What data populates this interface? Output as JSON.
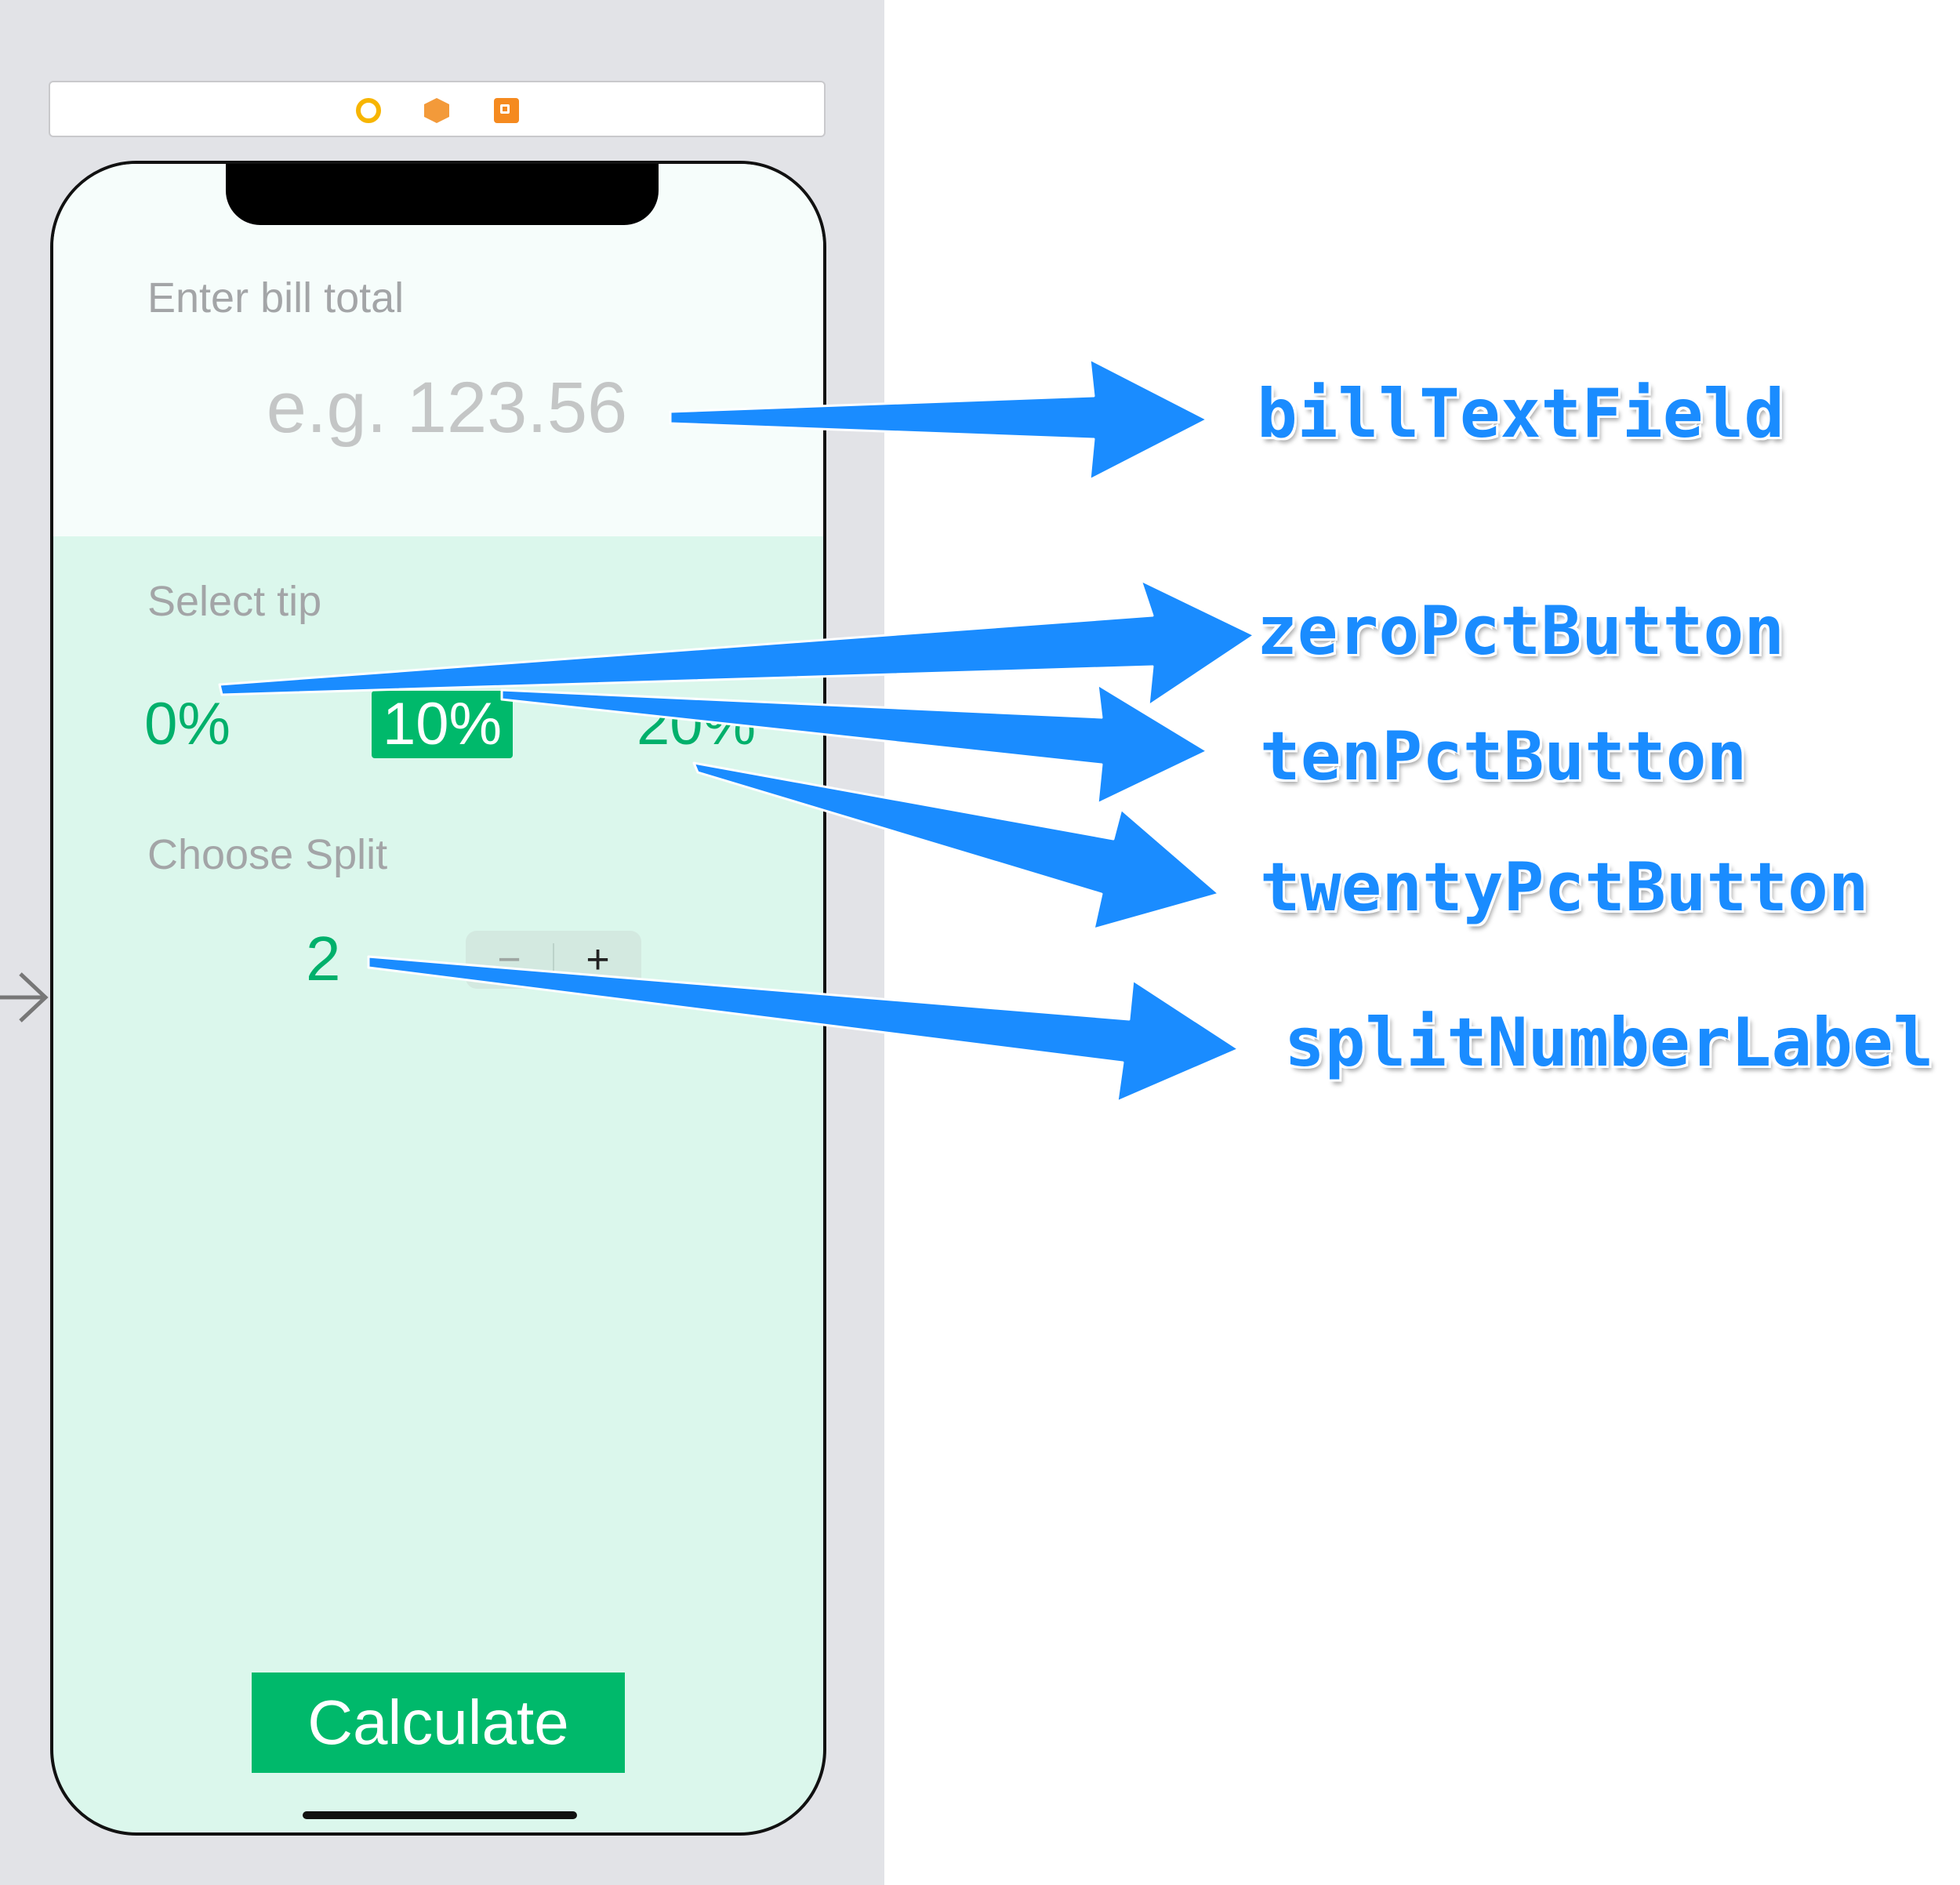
{
  "scene_dock": {
    "icons": [
      "view-controller-icon",
      "first-responder-icon",
      "exit-icon"
    ]
  },
  "app": {
    "bill_section": {
      "caption": "Enter bill total",
      "placeholder": "e.g. 123.56",
      "value": ""
    },
    "tip_section": {
      "caption": "Select tip",
      "options": [
        "0%",
        "10%",
        "20%"
      ],
      "selected": "10%"
    },
    "split_section": {
      "caption": "Choose Split",
      "number": "2",
      "stepper_minus": "−",
      "stepper_plus": "+"
    },
    "calculate_label": "Calculate"
  },
  "annotations": {
    "bill": "billTextField",
    "zero": "zeroPctButton",
    "ten": "tenPctButton",
    "twenty": "twentyPctButton",
    "split": "splitNumberLabel"
  },
  "colors": {
    "accent_green": "#00b96b",
    "annotation_blue": "#1a8cff",
    "background_mint": "#dbf7ec",
    "canvas_gray": "#e2e3e7"
  }
}
